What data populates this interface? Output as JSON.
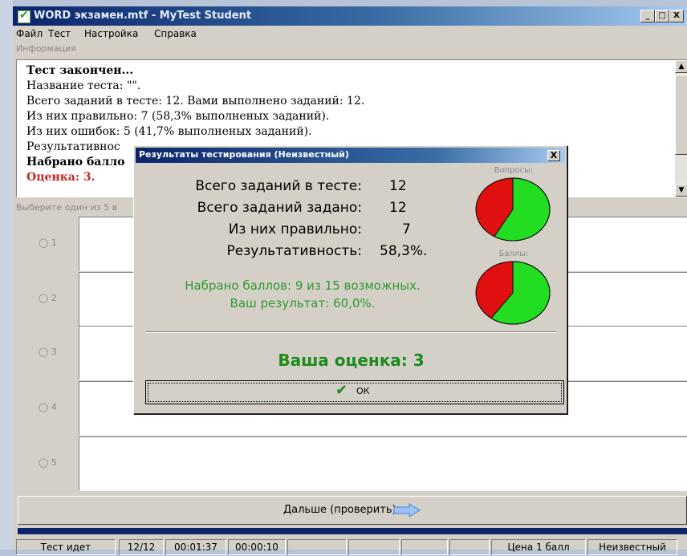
{
  "window": {
    "title": "WORD экзамен.mtf - MyTest Student",
    "min": "_",
    "max": "□",
    "close": "X"
  },
  "menu": [
    "Файл",
    "Тест",
    "Настройка",
    "Справка"
  ],
  "info_group": "Информация",
  "info_lines": [
    {
      "text": "Тест закончен...",
      "style": "bold"
    },
    {
      "text": "Название теста: \"\".",
      "style": ""
    },
    {
      "text": "Всего заданий в тесте: 12. Вами выполнено заданий: 12.",
      "style": ""
    },
    {
      "text": "Из них правильно: 7 (58,3% выполненых заданий).",
      "style": ""
    },
    {
      "text": "Из них ошибок: 5 (41,7% выполненых заданий).",
      "style": ""
    },
    {
      "text": "Результативнос",
      "style": ""
    },
    {
      "text": "Набрано балло",
      "style": "bold"
    },
    {
      "text": "Оценка: 3.",
      "style": "red"
    }
  ],
  "choose_label": "Выберите один из 5 в",
  "options": [
    "1",
    "2",
    "3",
    "4",
    "5"
  ],
  "next_button": "Дальше (проверить)",
  "status": [
    "Тест идет",
    "12/12",
    "00:01:37",
    "00:00:10",
    "",
    "",
    "",
    "",
    "Цена 1 балл",
    "Неизвестный"
  ],
  "dialog": {
    "title": "Результаты тестирования (Неизвестный)",
    "close": "X",
    "stats": [
      {
        "label": "Всего заданий в тесте:",
        "value": "12"
      },
      {
        "label": "Всего заданий задано:",
        "value": "12"
      },
      {
        "label": "Из них правильно:",
        "value": "7"
      },
      {
        "label": "Результативность:",
        "value": "58,3%."
      }
    ],
    "score_line1": "Набрано баллов: 9 из 15 возможных.",
    "score_line2": "Ваш результат: 60,0%.",
    "grade": "Ваша оценка: 3",
    "ok": "ОК",
    "pie1_caption": "Вопросы:",
    "pie2_caption": "Баллы:",
    "pie1": {
      "correct": 7,
      "total": 12
    },
    "pie2": {
      "correct": 9,
      "total": 15
    },
    "colors": {
      "correct": "#22dd22",
      "wrong": "#e01010"
    }
  }
}
